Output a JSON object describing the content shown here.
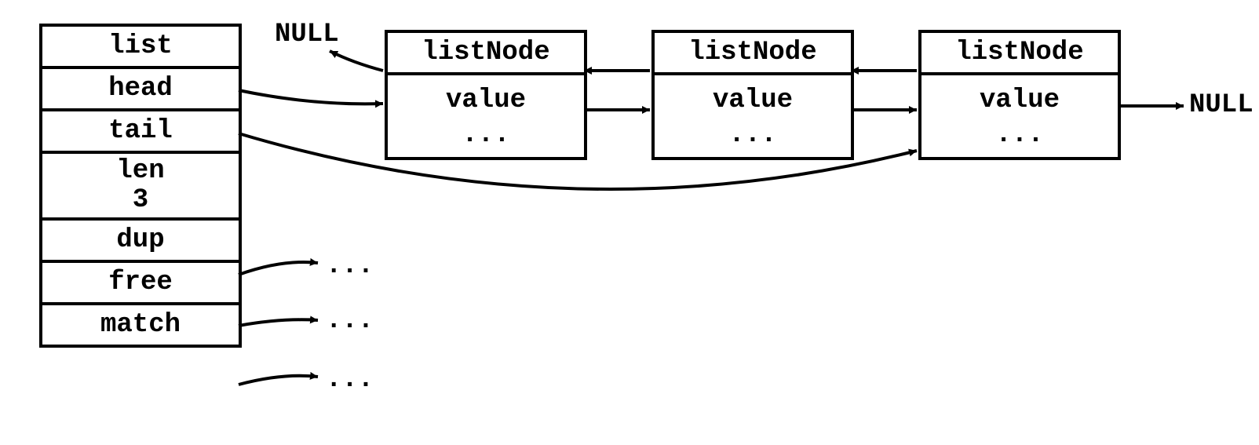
{
  "list_struct": {
    "title": "list",
    "fields": {
      "head": "head",
      "tail": "tail",
      "len_label": "len",
      "len_value": "3",
      "dup": "dup",
      "free": "free",
      "match": "match"
    }
  },
  "nodes": [
    {
      "title": "listNode",
      "value_label": "value",
      "dots": "..."
    },
    {
      "title": "listNode",
      "value_label": "value",
      "dots": "..."
    },
    {
      "title": "listNode",
      "value_label": "value",
      "dots": "..."
    }
  ],
  "nullLabels": {
    "left": "NULL",
    "right": "NULL"
  },
  "fnPtrDots": {
    "dup": "...",
    "free": "...",
    "match": "..."
  }
}
